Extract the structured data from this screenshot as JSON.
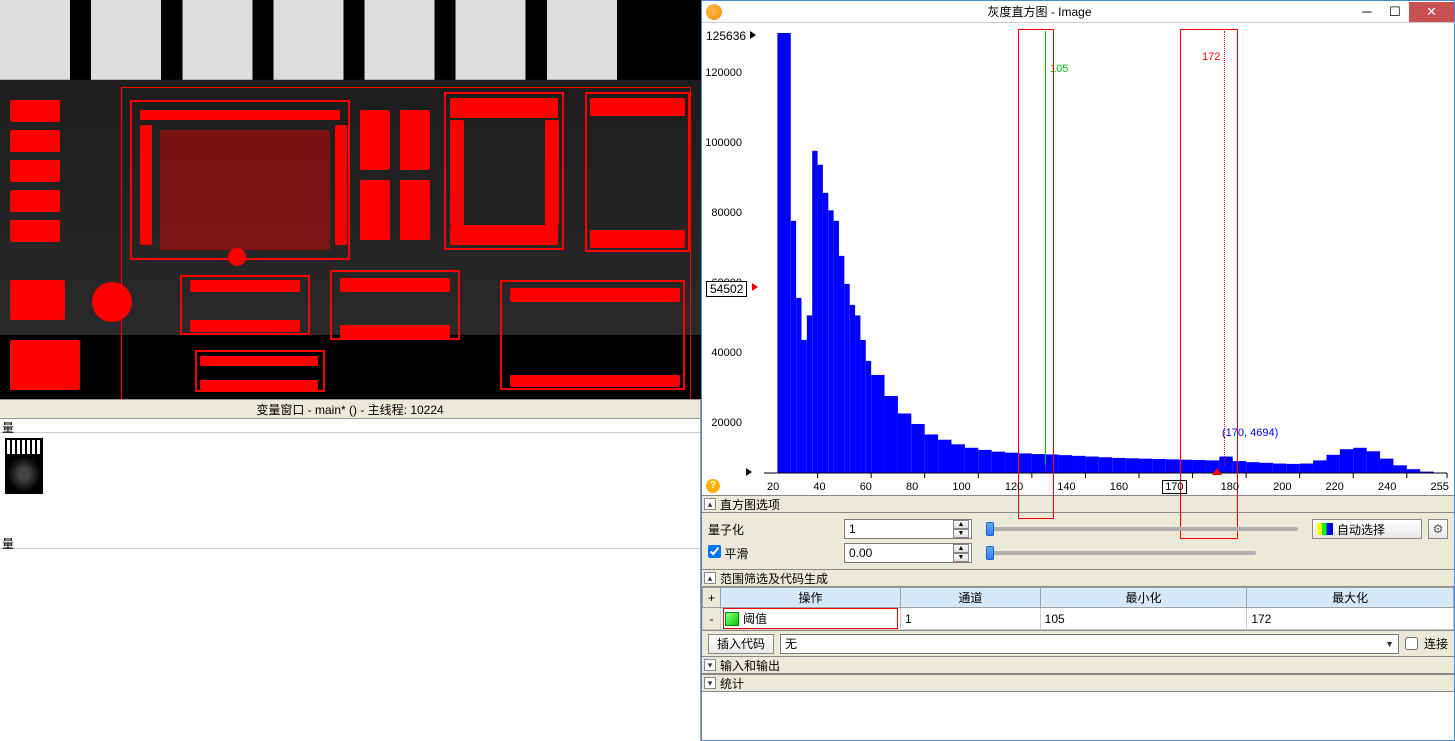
{
  "left": {
    "var_window_title": "变量窗口 - main* () - 主线程: 10224",
    "small_label_top": "量",
    "small_label_bottom": "量"
  },
  "window": {
    "title": "灰度直方图 - Image"
  },
  "chart_data": {
    "type": "bar",
    "title": "",
    "xlabel": "",
    "ylabel": "",
    "xlim": [
      0,
      255
    ],
    "ylim": [
      0,
      125636
    ],
    "x": [
      0,
      5,
      10,
      12,
      14,
      16,
      18,
      20,
      22,
      24,
      26,
      28,
      30,
      32,
      34,
      36,
      38,
      40,
      45,
      50,
      55,
      60,
      65,
      70,
      75,
      80,
      85,
      90,
      95,
      100,
      105,
      110,
      115,
      120,
      125,
      130,
      135,
      140,
      145,
      150,
      155,
      160,
      165,
      170,
      175,
      180,
      185,
      190,
      195,
      200,
      205,
      210,
      215,
      220,
      225,
      230,
      235,
      240,
      245,
      250,
      255
    ],
    "values": [
      0,
      125636,
      72000,
      50000,
      38000,
      45000,
      92000,
      88000,
      80000,
      75000,
      72000,
      62000,
      54000,
      48000,
      45000,
      38000,
      32000,
      28000,
      22000,
      17000,
      14000,
      11000,
      9500,
      8200,
      7200,
      6600,
      6100,
      5800,
      5600,
      5400,
      5300,
      5100,
      4900,
      4700,
      4500,
      4300,
      4200,
      4100,
      4000,
      3900,
      3800,
      3700,
      3600,
      4694,
      3400,
      3100,
      2900,
      2700,
      2600,
      2700,
      3600,
      5200,
      6800,
      7200,
      6200,
      4100,
      2200,
      1100,
      400,
      100,
      0
    ],
    "y_max_label": "125636",
    "y_cursor_value": "54502",
    "green_marker": {
      "x": 105,
      "label": "105"
    },
    "red_marker": {
      "x": 172,
      "label": "172"
    },
    "coord_label": "(170, 4694)",
    "x_ticks": [
      "20",
      "40",
      "60",
      "80",
      "100",
      "120",
      "140",
      "160",
      "170",
      "180",
      "200",
      "220",
      "240",
      "255"
    ],
    "y_ticks": [
      {
        "v": "120000",
        "pct": 4.5
      },
      {
        "v": "100000",
        "pct": 20.5
      },
      {
        "v": "80000",
        "pct": 36.5
      },
      {
        "v": "60000",
        "pct": 52.5
      },
      {
        "v": "40000",
        "pct": 68.5
      },
      {
        "v": "20000",
        "pct": 84.5
      },
      {
        "v": "0",
        "pct": 100
      }
    ]
  },
  "sections": {
    "histogram_options": "直方图选项",
    "quantization_label": "量子化",
    "quantization_value": "1",
    "smooth_label": "平滑",
    "smooth_value": "0.00",
    "auto_select": "自动选择",
    "range_filter": "范围筛选及代码生成",
    "io": "输入和输出",
    "stats": "统计"
  },
  "table": {
    "headers": {
      "plus": "+",
      "op": "操作",
      "channel": "通道",
      "min": "最小化",
      "max": "最大化"
    },
    "row": {
      "minus": "-",
      "op_label": "阈值",
      "channel": "1",
      "min": "105",
      "max": "172"
    }
  },
  "code": {
    "insert_label": "插入代码",
    "select_value": "无",
    "connect_label": "连接"
  }
}
